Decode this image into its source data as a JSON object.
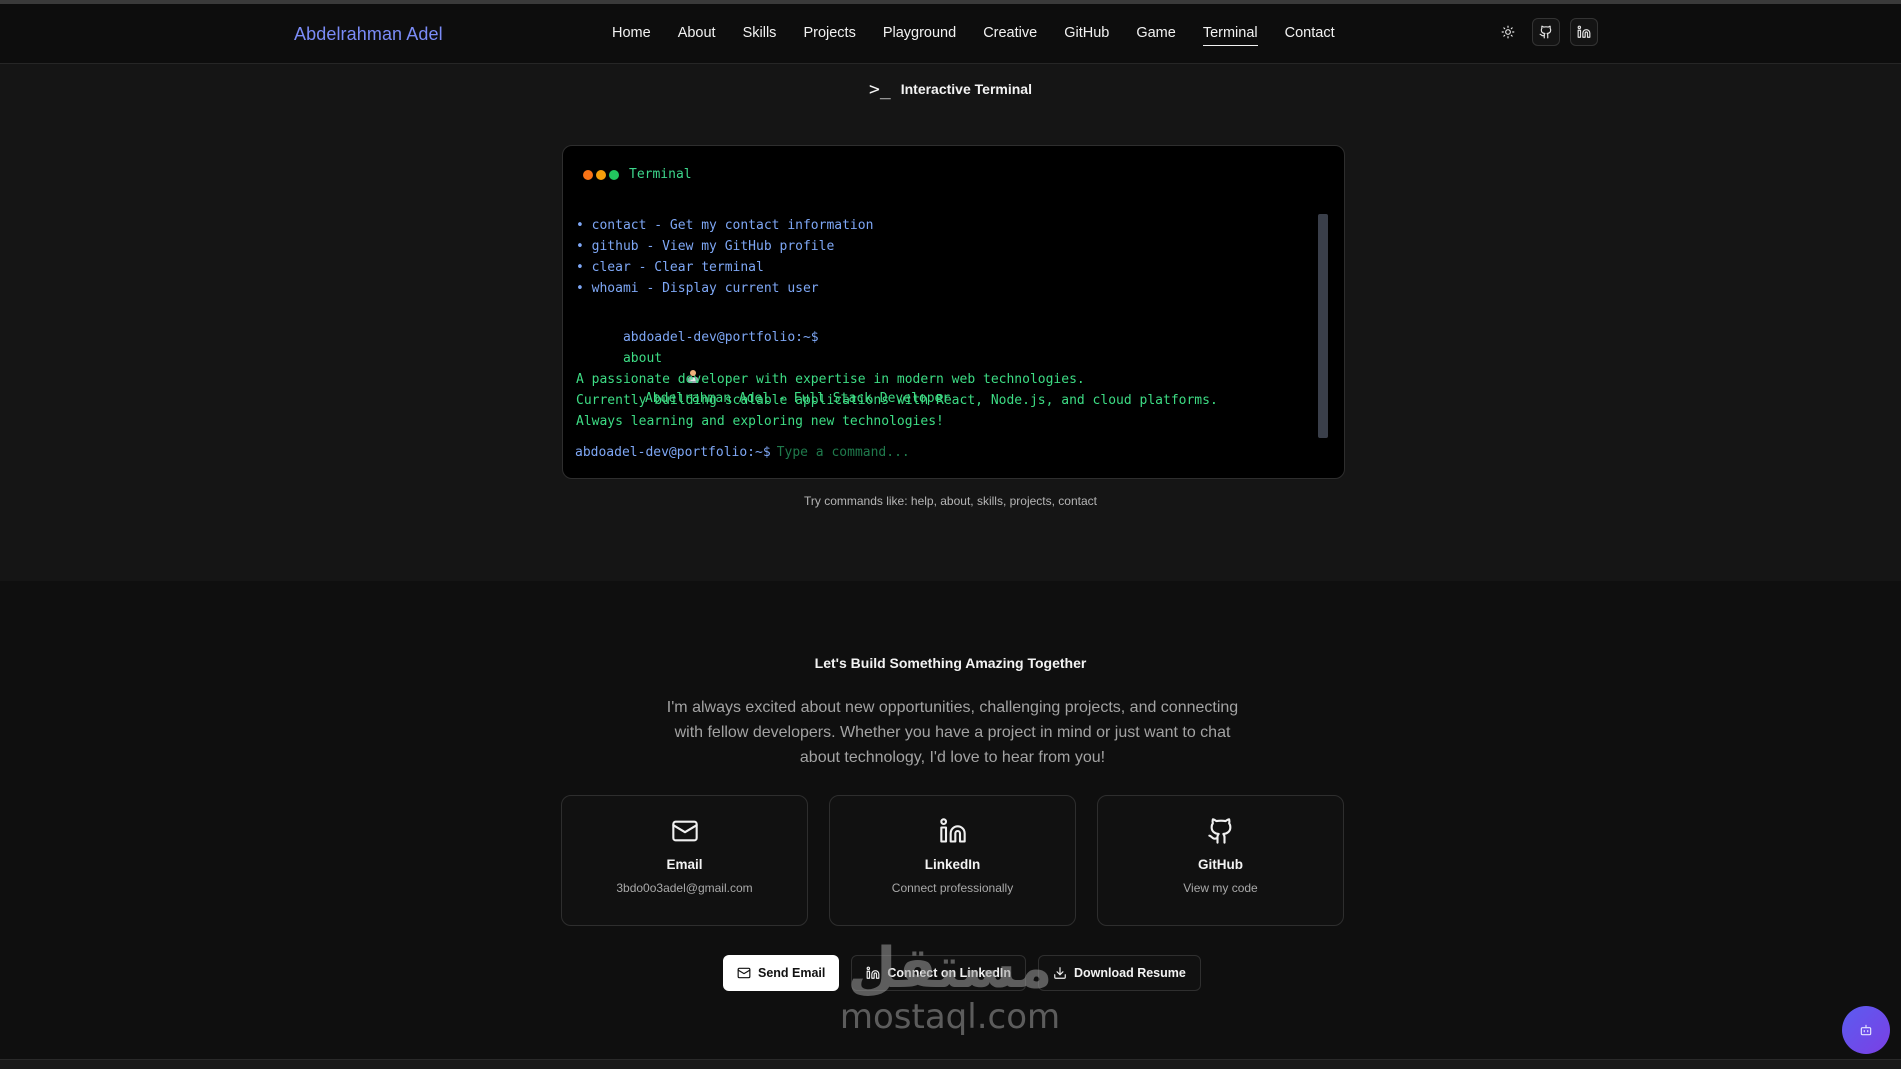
{
  "brand": "Abdelrahman Adel",
  "nav": {
    "links": [
      "Home",
      "About",
      "Skills",
      "Projects",
      "Playground",
      "Creative",
      "GitHub",
      "Game",
      "Terminal",
      "Contact"
    ],
    "active": "Terminal",
    "tools": [
      "sun-icon",
      "github-icon",
      "linkedin-icon"
    ]
  },
  "terminal_section": {
    "heading": "Interactive Terminal",
    "prompt_glyph": ">_",
    "window_title": "Terminal",
    "dot_colors": [
      "#f97316",
      "#f59e0b",
      "#22c55e"
    ],
    "lines": {
      "help1": "• contact - Get my contact information",
      "help2": "• github - View my GitHub profile",
      "help3": "• clear - Clear terminal",
      "help4": "• whoami - Display current user",
      "prompt": "abdoadel-dev@portfolio:~$",
      "command": "about",
      "about_title": "Abdelrahman Adel - Full Stack Developer",
      "about1": "A passionate developer with expertise in modern web technologies.",
      "about2": "Currently building scalable applications with React, Node.js, and cloud platforms.",
      "about3": "Always learning and exploring new technologies!"
    },
    "input_prompt": "abdoadel-dev@portfolio:~$",
    "input_placeholder": "Type a command...",
    "hint": "Try commands like: help, about, skills, projects, contact"
  },
  "contact": {
    "title": "Let's Build Something Amazing Together",
    "description": "I'm always excited about new opportunities, challenging projects, and connecting with fellow developers. Whether you have a project in mind or just want to chat about technology, I'd love to hear from you!",
    "cards": [
      {
        "icon": "mail-icon",
        "title": "Email",
        "subtitle": "3bdo0o3adel@gmail.com"
      },
      {
        "icon": "linkedin-icon",
        "title": "LinkedIn",
        "subtitle": "Connect professionally"
      },
      {
        "icon": "github-icon",
        "title": "GitHub",
        "subtitle": "View my code"
      }
    ],
    "buttons": {
      "send_email": "Send Email",
      "connect_linkedin": "Connect on LinkedIn",
      "download_resume": "Download Resume"
    }
  },
  "watermark": {
    "arabic": "مستقل",
    "latin": "mostaql.com"
  },
  "fab_icon": "bot-icon",
  "colors": {
    "brand": "#7b8cf7",
    "term_green": "#3ddc84",
    "term_blue": "#7ea7f5",
    "fab": "#6b4ee8"
  }
}
